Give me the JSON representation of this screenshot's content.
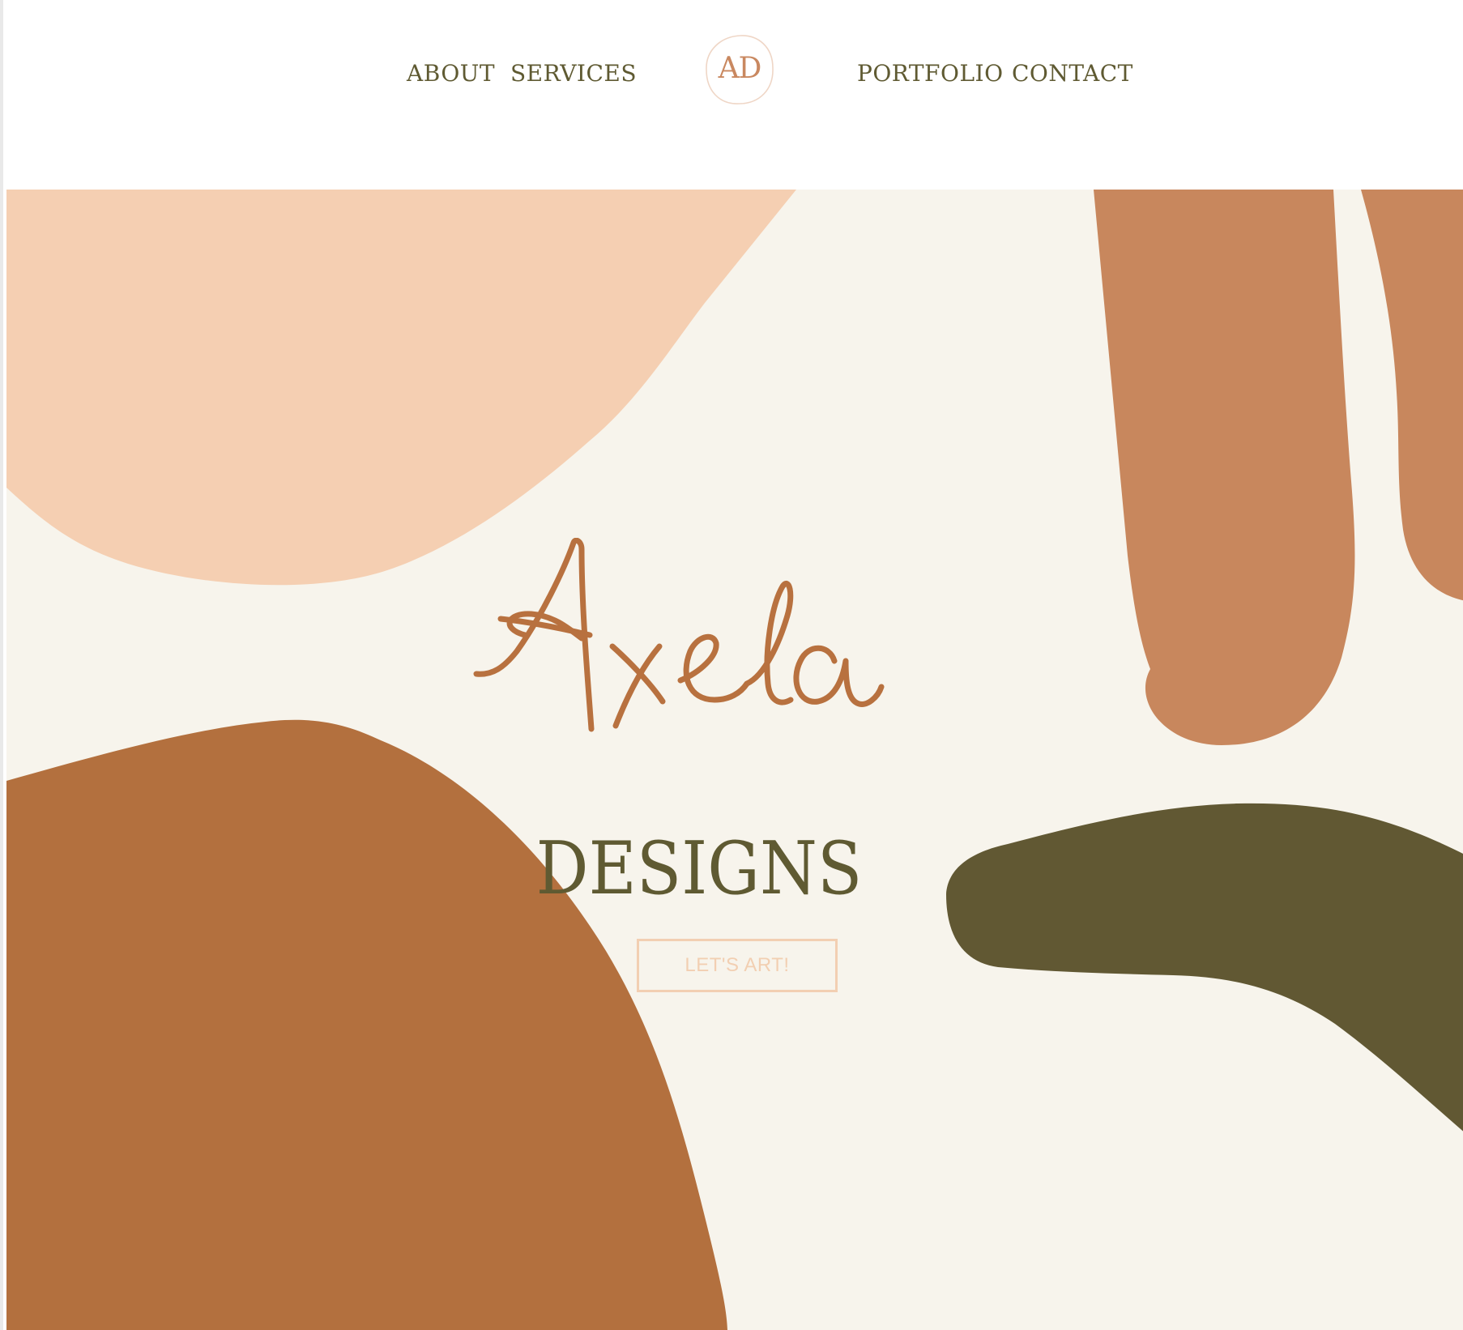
{
  "nav": {
    "about": "ABOUT",
    "services": "SERVICES",
    "portfolio": "PORTFOLIO",
    "contact": "CONTACT"
  },
  "logo": {
    "monogram": "AD"
  },
  "hero": {
    "script_title": "Axela",
    "subtitle": "DESIGNS",
    "cta_label": "LET'S ART!"
  },
  "colors": {
    "header_bg": "#ffffff",
    "hero_bg": "#f7f4ec",
    "peach": "#f5cfb2",
    "terracotta_light": "#c8875d",
    "terracotta_dark": "#b3703e",
    "olive": "#615833",
    "nav_text": "#5f5a32",
    "script_text": "#b8713f"
  }
}
